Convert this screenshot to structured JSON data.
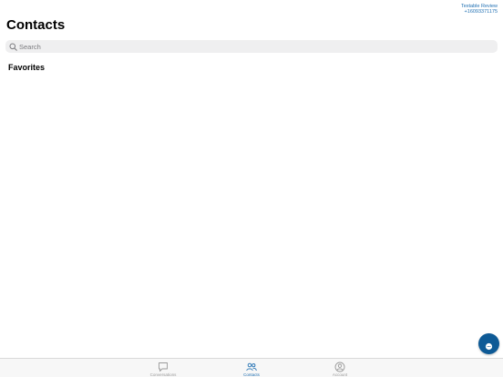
{
  "account": {
    "name": "Textable Review",
    "phone": "+16093371175"
  },
  "page": {
    "title": "Contacts"
  },
  "search": {
    "placeholder": "Search",
    "value": ""
  },
  "sections": {
    "favorites": "Favorites"
  },
  "fab": {
    "icon": "chat-bubble-icon"
  },
  "tabs": [
    {
      "label": "Conversations",
      "icon": "speech-bubble-icon",
      "active": false
    },
    {
      "label": "Contacts",
      "icon": "people-icon",
      "active": true
    },
    {
      "label": "Account",
      "icon": "user-circle-icon",
      "active": false
    }
  ],
  "colors": {
    "accent": "#1f6fb2",
    "fab": "#0e5a96",
    "inactive_tab": "#9a9a9a",
    "search_bg": "#efeff0"
  }
}
